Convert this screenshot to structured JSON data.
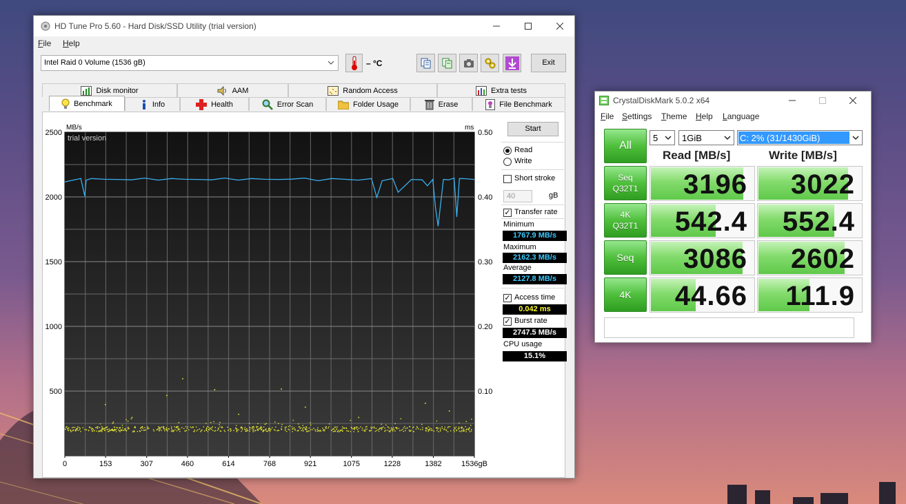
{
  "hdtune": {
    "title": "HD Tune Pro 5.60 - Hard Disk/SSD Utility (trial version)",
    "menu": [
      "File",
      "Help"
    ],
    "drive": "Intel   Raid 0 Volume (1536 gB)",
    "temperature": "– °C",
    "exit_label": "Exit",
    "tabs_row1": [
      "Disk monitor",
      "AAM",
      "Random Access",
      "Extra tests"
    ],
    "tabs_row2": [
      "Benchmark",
      "Info",
      "Health",
      "Error Scan",
      "Folder Usage",
      "Erase",
      "File Benchmark"
    ],
    "active_tab": "Benchmark",
    "side": {
      "start_label": "Start",
      "read_label": "Read",
      "write_label": "Write",
      "read_selected": true,
      "short_stroke_label": "Short stroke",
      "short_stroke_checked": false,
      "short_stroke_value": "40",
      "short_stroke_unit": "gB",
      "transfer_rate_label": "Transfer rate",
      "transfer_rate_checked": true,
      "minimum_label": "Minimum",
      "minimum_value": "1767.9 MB/s",
      "maximum_label": "Maximum",
      "maximum_value": "2162.3 MB/s",
      "average_label": "Average",
      "average_value": "2127.8 MB/s",
      "access_time_label": "Access time",
      "access_time_checked": true,
      "access_time_value": "0.042 ms",
      "burst_rate_label": "Burst rate",
      "burst_rate_checked": true,
      "burst_rate_value": "2747.5 MB/s",
      "cpu_usage_label": "CPU usage",
      "cpu_usage_value": "15.1%"
    },
    "colors": {
      "transfer_line": "#3ab0f0",
      "access_dots": "#e8e832",
      "chart_bg": "#262626",
      "grid": "#6a6a6a"
    },
    "chart_data": {
      "type": "line",
      "watermark": "trial version",
      "ylabel_left": "MB/s",
      "ylabel_right": "ms",
      "ylim_left": [
        0,
        2500
      ],
      "ylim_right": [
        0,
        0.5
      ],
      "y_ticks_left": [
        "500",
        "1000",
        "1500",
        "2000",
        "2500"
      ],
      "y_ticks_right": [
        "0.10",
        "0.20",
        "0.30",
        "0.40",
        "0.50"
      ],
      "x_ticks": [
        "0",
        "153",
        "307",
        "460",
        "614",
        "768",
        "921",
        "1075",
        "1228",
        "1382",
        "1536gB"
      ],
      "xlim": [
        0,
        1536
      ],
      "series": [
        {
          "axis": "left",
          "x": [
            0,
            20,
            60,
            75,
            80,
            100,
            150,
            200,
            250,
            300,
            350,
            400,
            450,
            500,
            550,
            600,
            650,
            700,
            750,
            800,
            850,
            900,
            950,
            1000,
            1050,
            1100,
            1150,
            1170,
            1190,
            1230,
            1250,
            1300,
            1340,
            1360,
            1380,
            1390,
            1400,
            1420,
            1440,
            1460,
            1470,
            1480,
            1500,
            1536
          ],
          "y": [
            2110,
            2130,
            2140,
            2000,
            2135,
            2140,
            2130,
            2140,
            2130,
            2140,
            2135,
            2140,
            2130,
            2140,
            2130,
            2140,
            2135,
            2140,
            2130,
            2140,
            2135,
            2140,
            2130,
            2140,
            2130,
            2135,
            2140,
            1990,
            2130,
            2140,
            2030,
            2140,
            2130,
            2080,
            2140,
            1920,
            1768,
            2140,
            2130,
            2140,
            1850,
            2140,
            2135,
            2140
          ]
        },
        {
          "axis": "right",
          "type": "scatter",
          "x_range": [
            0,
            1536
          ],
          "y_band": [
            0.038,
            0.046
          ],
          "outliers": [
            [
              440,
              0.12
            ],
            [
              560,
              0.103
            ],
            [
              810,
              0.104
            ],
            [
              380,
              0.094
            ],
            [
              150,
              0.08
            ],
            [
              900,
              0.076
            ],
            [
              1350,
              0.082
            ],
            [
              1440,
              0.07
            ],
            [
              250,
              0.06
            ],
            [
              650,
              0.065
            ],
            [
              1100,
              0.06
            ]
          ]
        }
      ]
    }
  },
  "cdm": {
    "title": "CrystalDiskMark 5.0.2 x64",
    "menu": [
      "File",
      "Settings",
      "Theme",
      "Help",
      "Language"
    ],
    "all_label": "All",
    "count": "5",
    "size": "1GiB",
    "drive": "C: 2% (31/1430GiB)",
    "read_header": "Read [MB/s]",
    "write_header": "Write [MB/s]",
    "rows": [
      {
        "line1": "Seq",
        "line2": "Q32T1",
        "read": "3196",
        "write": "3022",
        "read_fill": 0.89,
        "write_fill": 0.86
      },
      {
        "line1": "4K",
        "line2": "Q32T1",
        "read": "542.4",
        "write": "552.4",
        "read_fill": 0.62,
        "write_fill": 0.73
      },
      {
        "line1": "Seq",
        "line2": "",
        "read": "3086",
        "write": "2602",
        "read_fill": 0.88,
        "write_fill": 0.83
      },
      {
        "line1": "4K",
        "line2": "",
        "read": "44.66",
        "write": "111.9",
        "read_fill": 0.43,
        "write_fill": 0.49
      }
    ],
    "comment": ""
  }
}
